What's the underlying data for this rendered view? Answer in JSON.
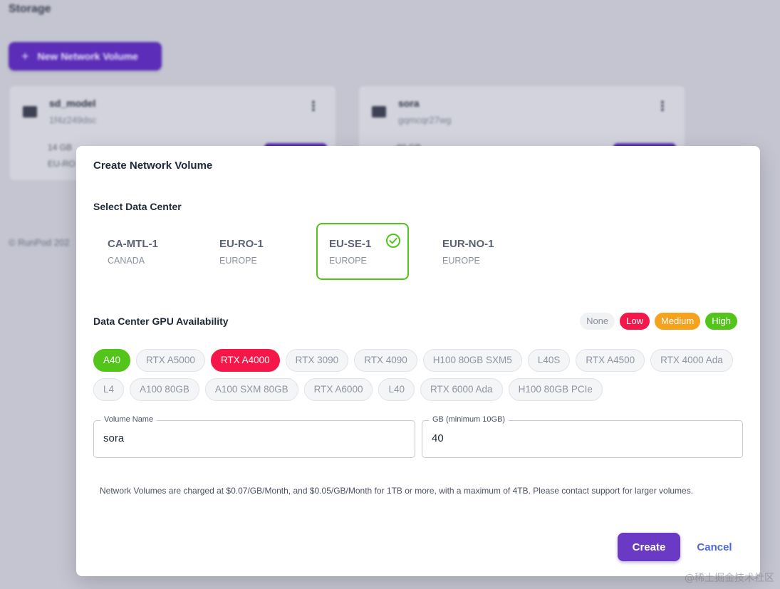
{
  "background": {
    "title": "Storage",
    "new_volume_label": "New Network Volume",
    "cards": [
      {
        "name": "sd_model",
        "id": "1f4z249dsc",
        "size": "14 GB",
        "location": "EU-RO"
      },
      {
        "name": "sora",
        "id": "gqmcqr27wg",
        "size": "80 GB",
        "location": ""
      }
    ],
    "footer": "© RunPod 202"
  },
  "modal": {
    "title": "Create Network Volume",
    "data_center_title": "Select Data Center",
    "data_centers": [
      {
        "code": "CA-MTL-1",
        "region": "CANADA",
        "selected": false
      },
      {
        "code": "EU-RO-1",
        "region": "EUROPE",
        "selected": false
      },
      {
        "code": "EU-SE-1",
        "region": "EUROPE",
        "selected": true
      },
      {
        "code": "EUR-NO-1",
        "region": "EUROPE",
        "selected": false
      }
    ],
    "gpu_title": "Data Center GPU Availability",
    "legend": [
      {
        "label": "None",
        "level": "none"
      },
      {
        "label": "Low",
        "level": "low"
      },
      {
        "label": "Medium",
        "level": "medium"
      },
      {
        "label": "High",
        "level": "high"
      }
    ],
    "gpus_row1": [
      {
        "label": "A40",
        "level": "high"
      },
      {
        "label": "RTX A5000",
        "level": "none"
      },
      {
        "label": "RTX A4000",
        "level": "low"
      },
      {
        "label": "RTX 3090",
        "level": "none"
      },
      {
        "label": "RTX 4090",
        "level": "none"
      },
      {
        "label": "H100 80GB SXM5",
        "level": "none"
      },
      {
        "label": "L40S",
        "level": "none"
      },
      {
        "label": "RTX A4500",
        "level": "none"
      },
      {
        "label": "RTX 4000 Ada",
        "level": "none"
      }
    ],
    "gpus_row2": [
      {
        "label": "L4",
        "level": "none"
      },
      {
        "label": "A100 80GB",
        "level": "none"
      },
      {
        "label": "A100 SXM 80GB",
        "level": "none"
      },
      {
        "label": "RTX A6000",
        "level": "none"
      },
      {
        "label": "L40",
        "level": "none"
      },
      {
        "label": "RTX 6000 Ada",
        "level": "none"
      },
      {
        "label": "H100 80GB PCIe",
        "level": "none"
      }
    ],
    "volume_name": {
      "label": "Volume Name",
      "value": "sora"
    },
    "volume_size": {
      "label": "GB (minimum 10GB)",
      "value": "40"
    },
    "note": "Network Volumes are charged at $0.07/GB/Month, and $0.05/GB/Month for 1TB or more, with a maximum of 4TB. Please contact support for larger volumes.",
    "create_label": "Create",
    "cancel_label": "Cancel"
  },
  "colors": {
    "primary": "#6a3ac4",
    "selected_border": "#52c41a",
    "high": "#52c41a",
    "medium": "#f6a21c",
    "low": "#f5174a",
    "link": "#4f6ad8"
  },
  "watermark": "@稀土掘金技术社区"
}
